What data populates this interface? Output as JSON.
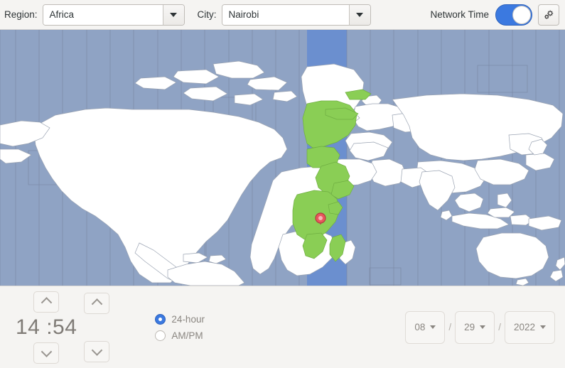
{
  "toolbar": {
    "region_label": "Region:",
    "region_value": "Africa",
    "city_label": "City:",
    "city_value": "Nairobi",
    "network_time_label": "Network Time",
    "network_time_on": true,
    "toggle_icon": "toggle-switch-on",
    "settings_icon": "gear-icon",
    "region_dropdown_icon": "chevron-down-icon",
    "city_dropdown_icon": "chevron-down-icon"
  },
  "map": {
    "ocean_color": "#8fa3c4",
    "land_color": "#ffffff",
    "highlight_color": "#8ace55",
    "selected_zone_color": "#6b8fcf",
    "border_color": "#8a8f99",
    "marker_icon": "map-pin-marker",
    "marker_color": "#e8575c",
    "marker_city": "Nairobi"
  },
  "time": {
    "hours": "14",
    "separator": ":",
    "minutes": "54",
    "display": "14 :54",
    "hour_up_icon": "chevron-up-icon",
    "hour_down_icon": "chevron-down-icon",
    "minute_up_icon": "chevron-up-icon",
    "minute_down_icon": "chevron-down-icon"
  },
  "format": {
    "options": [
      {
        "label": "24-hour",
        "selected": true
      },
      {
        "label": "AM/PM",
        "selected": false
      }
    ]
  },
  "date": {
    "month": "08",
    "day": "29",
    "year": "2022",
    "separator": "/",
    "month_dropdown_icon": "chevron-down-icon",
    "day_dropdown_icon": "chevron-down-icon",
    "year_dropdown_icon": "chevron-down-icon"
  },
  "colors": {
    "accent": "#3b79e0",
    "background": "#f5f4f2",
    "text": "#2e3436",
    "muted_text": "#8a8681"
  }
}
